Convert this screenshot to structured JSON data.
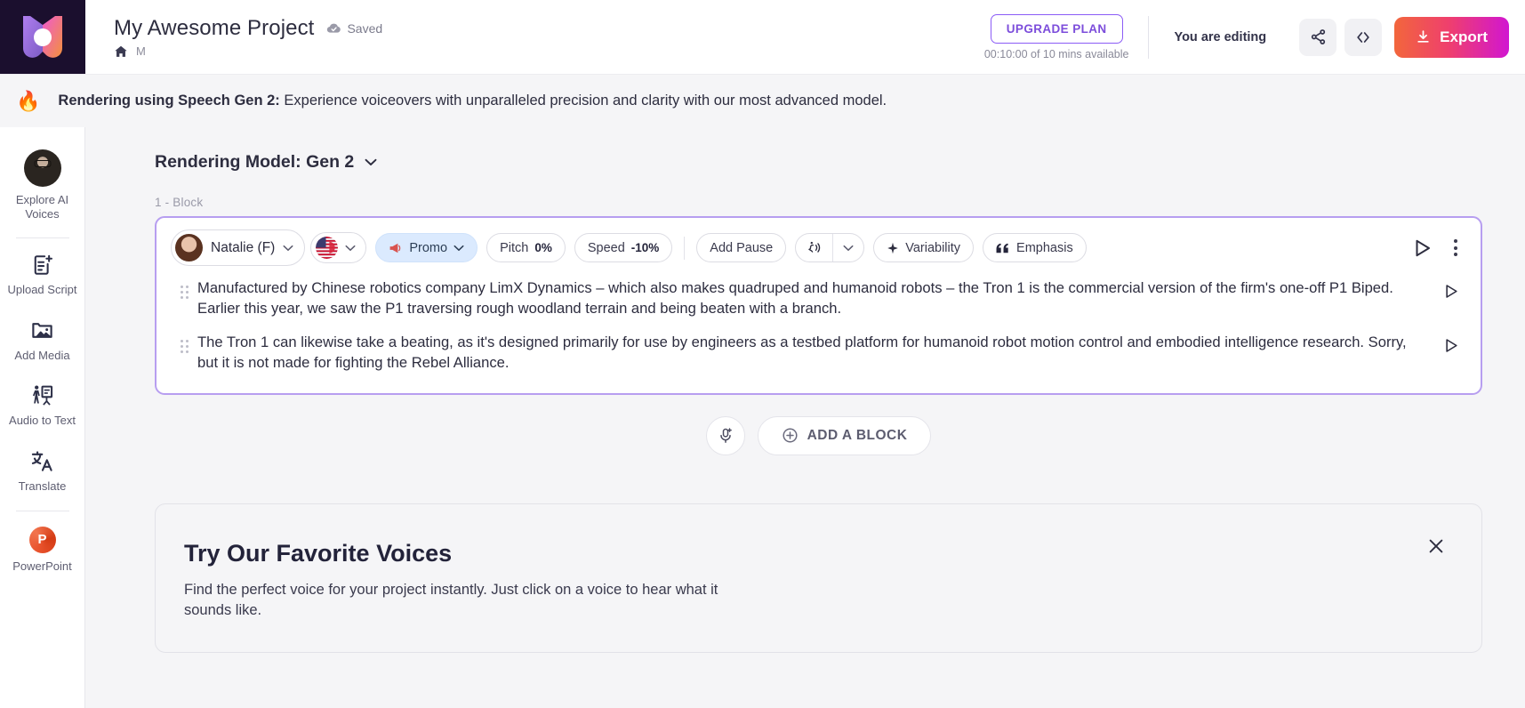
{
  "header": {
    "logo_name": "app-logo",
    "project_title": "My Awesome Project",
    "saved_label": "Saved",
    "breadcrumb_text": "M",
    "upgrade_label": "UPGRADE PLAN",
    "plan_sub": "00:10:00 of 10 mins available",
    "editing_status": "You are editing",
    "share_icon": "share-icon",
    "code_icon": "code-icon",
    "export_label": "Export",
    "export_gradient_from": "#f2663c",
    "export_gradient_to": "#d116d1",
    "upgrade_accent": "#8b5cf6"
  },
  "banner": {
    "icon": "flame-icon",
    "bold_text": "Rendering using Speech Gen 2:",
    "text": " Experience voiceovers with unparalleled precision and clarity with our most advanced model."
  },
  "sidebar": {
    "items": [
      {
        "label": "Explore AI Voices",
        "icon": "avatar-icon"
      },
      {
        "label": "Upload Script",
        "icon": "document-upload-icon"
      },
      {
        "label": "Add Media",
        "icon": "media-folder-icon"
      },
      {
        "label": "Audio to Text",
        "icon": "presenter-icon"
      },
      {
        "label": "Translate",
        "icon": "translate-icon"
      },
      {
        "label": "PowerPoint",
        "icon": "powerpoint-icon"
      }
    ]
  },
  "main": {
    "model_title": "Rendering Model: Gen 2",
    "model_chevron": "chevron-down-icon",
    "block_label": "1 -  Block",
    "toolbar": {
      "voice_name": "Natalie (F)",
      "voice_chevron": "chevron-down-icon",
      "language_icon": "us-flag-icon",
      "language_chevron": "chevron-down-icon",
      "style_label": "Promo",
      "style_icon": "megaphone-icon",
      "pitch_label": "Pitch",
      "pitch_value": "0%",
      "speed_label": "Speed",
      "speed_value": "-10%",
      "add_pause_label": "Add Pause",
      "sound_icon": "sound-wave-icon",
      "sound_chevron": "chevron-down-icon",
      "variability_label": "Variability",
      "variability_icon": "sparkle-icon",
      "emphasis_label": "Emphasis",
      "emphasis_icon": "quote-icon",
      "play_icon": "play-icon",
      "menu_icon": "more-vertical-icon"
    },
    "paragraphs": [
      "Manufactured by Chinese robotics company LimX Dynamics – which also makes quadruped and humanoid robots – the Tron 1 is the commercial version of the firm's one-off P1 Biped. Earlier this year, we saw the P1 traversing rough woodland terrain and being beaten with a branch.",
      "The Tron 1 can likewise take a beating, as it's designed primarily for use by engineers as a testbed platform for humanoid robot motion control and embodied intelligence research. Sorry, but it is not made for fighting the Rebel Alliance."
    ],
    "add_row": {
      "mic_icon": "mic-add-icon",
      "add_block_label": "ADD A BLOCK",
      "add_block_icon": "plus-circle-icon"
    },
    "favorites": {
      "title": "Try Our Favorite Voices",
      "subtitle": "Find the perfect voice for your project instantly. Just click on a voice to hear what it sounds like.",
      "close_icon": "close-icon"
    }
  }
}
